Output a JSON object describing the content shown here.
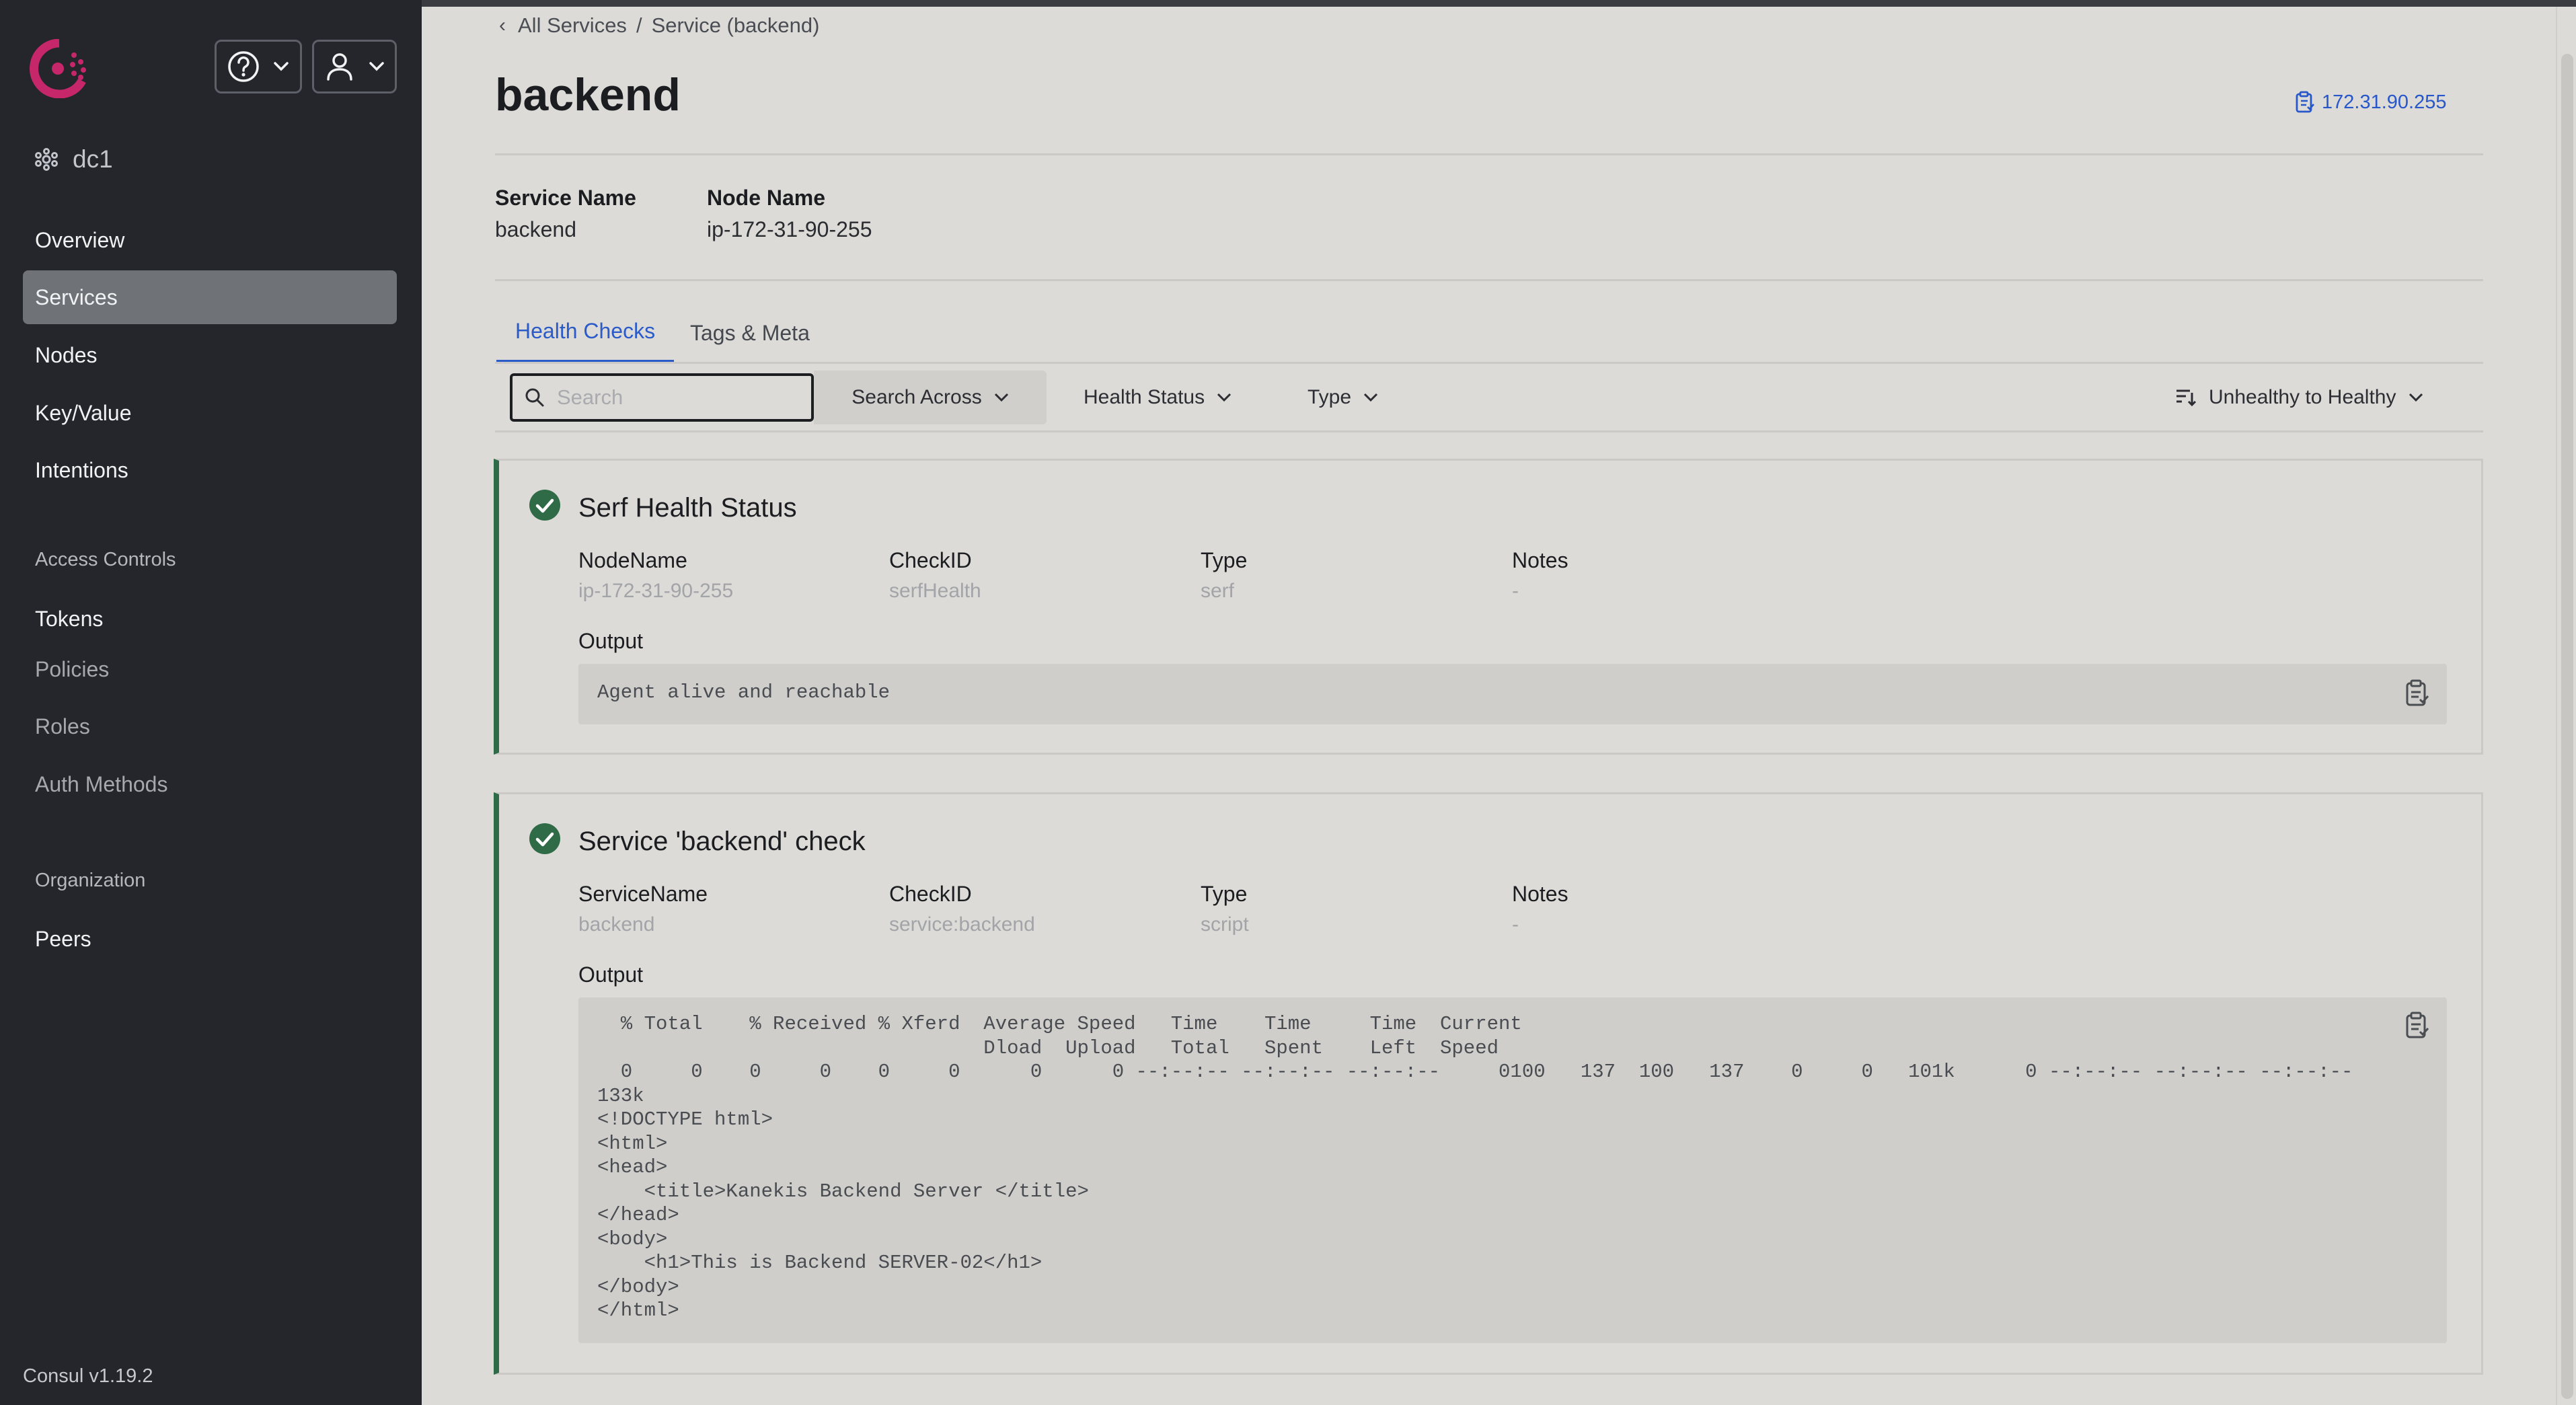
{
  "sidebar": {
    "datacenter": "dc1",
    "nav": [
      {
        "label": "Overview"
      },
      {
        "label": "Services"
      },
      {
        "label": "Nodes"
      },
      {
        "label": "Key/Value"
      },
      {
        "label": "Intentions"
      }
    ],
    "access_controls": {
      "heading": "Access Controls",
      "items": [
        {
          "label": "Tokens"
        },
        {
          "label": "Policies"
        },
        {
          "label": "Roles"
        },
        {
          "label": "Auth Methods"
        }
      ]
    },
    "organization": {
      "heading": "Organization",
      "items": [
        {
          "label": "Peers"
        }
      ]
    },
    "version": "Consul v1.19.2"
  },
  "breadcrumb": {
    "parent": "All Services",
    "separator": "/",
    "current": "Service (backend)"
  },
  "page": {
    "title": "backend",
    "ip_address": "172.31.90.255"
  },
  "meta": {
    "service_name_label": "Service Name",
    "service_name_value": "backend",
    "node_name_label": "Node Name",
    "node_name_value": "ip-172-31-90-255"
  },
  "tabs": [
    {
      "label": "Health Checks"
    },
    {
      "label": "Tags & Meta"
    }
  ],
  "filters": {
    "search_placeholder": "Search",
    "search_value": "",
    "search_across": "Search Across",
    "health_status": "Health Status",
    "type": "Type",
    "sort": "Unhealthy to Healthy"
  },
  "checks": [
    {
      "title": "Serf Health Status",
      "status": "passing",
      "fields": [
        {
          "label": "NodeName",
          "value": "ip-172-31-90-255"
        },
        {
          "label": "CheckID",
          "value": "serfHealth"
        },
        {
          "label": "Type",
          "value": "serf"
        },
        {
          "label": "Notes",
          "value": "-"
        }
      ],
      "output_label": "Output",
      "output": "Agent alive and reachable"
    },
    {
      "title": "Service 'backend' check",
      "status": "passing",
      "fields": [
        {
          "label": "ServiceName",
          "value": "backend"
        },
        {
          "label": "CheckID",
          "value": "service:backend"
        },
        {
          "label": "Type",
          "value": "script"
        },
        {
          "label": "Notes",
          "value": "-"
        }
      ],
      "output_label": "Output",
      "output": "  % Total    % Received % Xferd  Average Speed   Time    Time     Time  Current\n                                 Dload  Upload   Total   Spent    Left  Speed\n  0     0    0     0    0     0      0      0 --:--:-- --:--:-- --:--:--     0100   137  100   137    0     0   101k      0 --:--:-- --:--:-- --:--:--\n133k\n<!DOCTYPE html>\n<html>\n<head>\n    <title>Kanekis Backend Server </title>\n</head>\n<body>\n    <h1>This is Backend SERVER-02</h1>\n</body>\n</html>"
    }
  ],
  "colors": {
    "sidebar_bg": "#24262b",
    "active_nav_bg": "#6f7378",
    "accent_blue": "#2a5bc9",
    "passing_green": "#2f6b46",
    "brand_pink": "#c6266a"
  }
}
